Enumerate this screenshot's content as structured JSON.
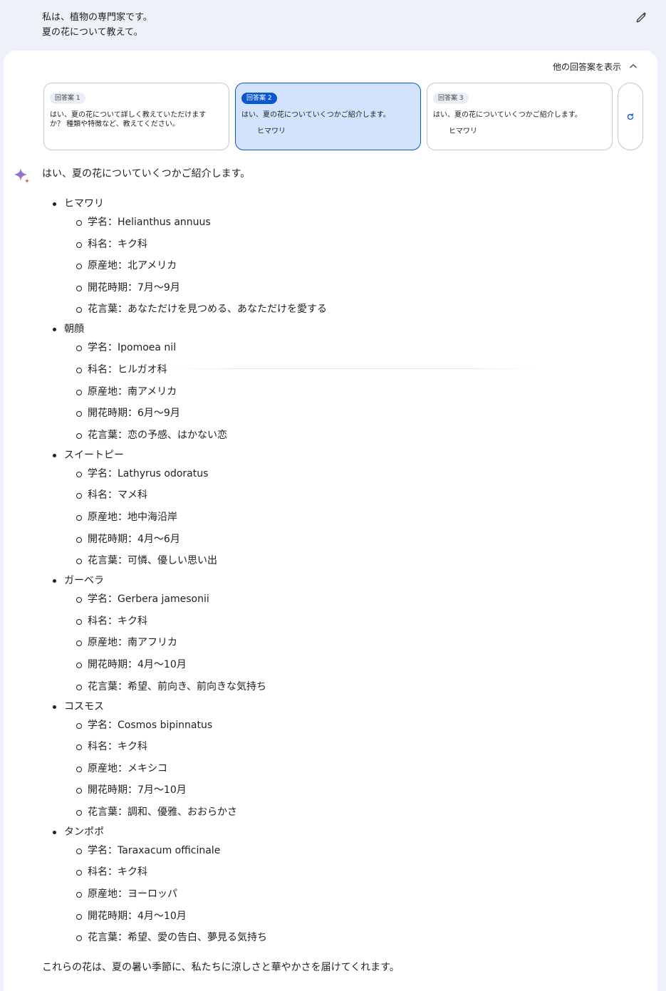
{
  "prompt": {
    "lines": [
      "私は、植物の専門家です。",
      "夏の花について教えて。"
    ]
  },
  "header": {
    "other_drafts_label": "他の回答案を表示"
  },
  "drafts": [
    {
      "label": "回答案 1",
      "text": "はい、夏の花について詳しく教えていただけますか？ 種類や特徴など、教えてください。",
      "peek": ""
    },
    {
      "label": "回答案 2",
      "text": "はい、夏の花についていくつかご紹介します。",
      "peek": "ヒマワリ"
    },
    {
      "label": "回答案 3",
      "text": "はい、夏の花についていくつかご紹介します。",
      "peek": "ヒマワリ"
    }
  ],
  "response": {
    "intro": "はい、夏の花についていくつかご紹介します。",
    "flowers": [
      {
        "name": "ヒマワリ",
        "props": [
          "学名：Helianthus annuus",
          "科名：キク科",
          "原産地：北アメリカ",
          "開花時期：7月～9月",
          "花言葉：あなただけを見つめる、あなただけを愛する"
        ]
      },
      {
        "name": "朝顔",
        "props": [
          "学名：Ipomoea nil",
          "科名：ヒルガオ科",
          "原産地：南アメリカ",
          "開花時期：6月～9月",
          "花言葉：恋の予感、はかない恋"
        ]
      },
      {
        "name": "スイートピー",
        "props": [
          "学名：Lathyrus odoratus",
          "科名：マメ科",
          "原産地：地中海沿岸",
          "開花時期：4月～6月",
          "花言葉：可憐、優しい思い出"
        ]
      },
      {
        "name": "ガーベラ",
        "props": [
          "学名：Gerbera jamesonii",
          "科名：キク科",
          "原産地：南アフリカ",
          "開花時期：4月～10月",
          "花言葉：希望、前向き、前向きな気持ち"
        ]
      },
      {
        "name": "コスモス",
        "props": [
          "学名：Cosmos bipinnatus",
          "科名：キク科",
          "原産地：メキシコ",
          "開花時期：7月～10月",
          "花言葉：調和、優雅、おおらかさ"
        ]
      },
      {
        "name": "タンポポ",
        "props": [
          "学名：Taraxacum officinale",
          "科名：キク科",
          "原産地：ヨーロッパ",
          "開花時期：4月～10月",
          "花言葉：希望、愛の告白、夢見る気持ち"
        ]
      }
    ],
    "outro": "これらの花は、夏の暑い季節に、私たちに涼しさと華やかさを届けてくれます。"
  },
  "icons": {
    "edit": "pencil-icon",
    "collapse": "chevron-up-icon",
    "regenerate": "refresh-icon",
    "assistant": "sparkle-icon"
  },
  "colors": {
    "page_background": "#eef1f8",
    "panel_background": "#ffffff",
    "selected_draft_background": "#d3e3fd",
    "accent_blue": "#0b57d0",
    "text": "#1f1f1f"
  }
}
